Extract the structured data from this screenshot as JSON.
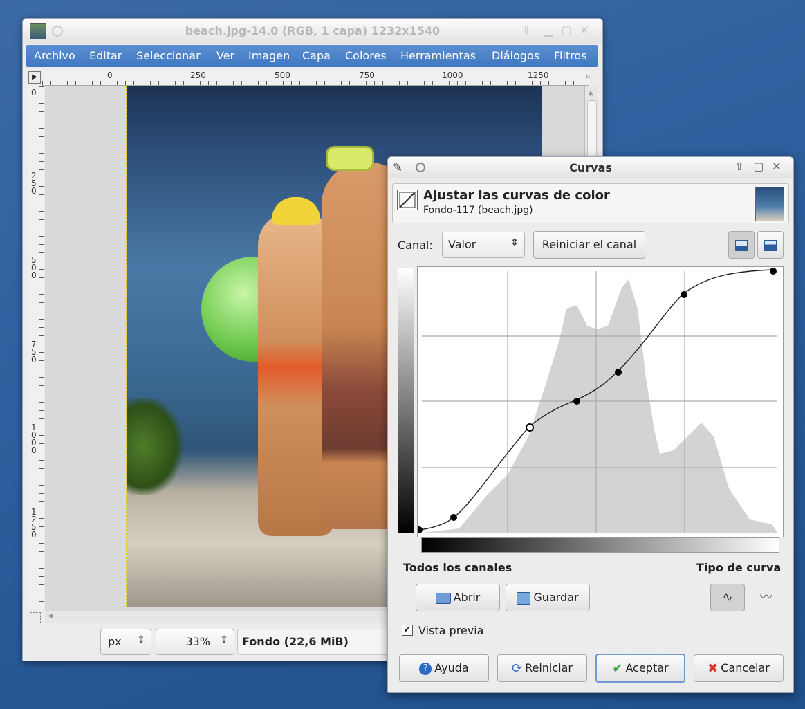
{
  "main_window": {
    "title": "beach.jpg-14.0 (RGB, 1 capa) 1232x1540",
    "menu": [
      "Archivo",
      "Editar",
      "Seleccionar",
      "Ver",
      "Imagen",
      "Capa",
      "Colores",
      "Herramientas",
      "Diálogos",
      "Filtros"
    ],
    "ruler_h": [
      "0",
      "250",
      "500",
      "750",
      "1000",
      "1250"
    ],
    "ruler_v": [
      "0",
      "250",
      "500",
      "750",
      "1000",
      "1250"
    ],
    "status": {
      "unit": "px",
      "zoom": "33%",
      "layer_info": "Fondo (22,6 MiB)"
    }
  },
  "curves_dialog": {
    "title": "Curvas",
    "heading": "Ajustar las curvas de color",
    "subheading": "Fondo-117 (beach.jpg)",
    "channel_label": "Canal:",
    "channel_value": "Valor",
    "reset_channel": "Reiniciar el canal",
    "all_channels": "Todos los canales",
    "curve_type": "Tipo de curva",
    "open": "Abrir",
    "save": "Guardar",
    "preview": "Vista previa",
    "preview_checked": true,
    "help": "Ayuda",
    "reset": "Reiniciar",
    "ok": "Aceptar",
    "cancel": "Cancelar",
    "colors": {
      "accent": "#4a7fc5",
      "ok_check": "#3aa64a",
      "cancel_x": "#d8352a"
    },
    "icons": [
      "gimp-icon",
      "curves-tool-icon",
      "histogram-linear-icon",
      "histogram-log-icon",
      "folder-open-icon",
      "save-icon",
      "help-icon",
      "reset-icon",
      "check-icon",
      "cancel-icon",
      "smooth-curve-icon",
      "freehand-curve-icon"
    ]
  }
}
